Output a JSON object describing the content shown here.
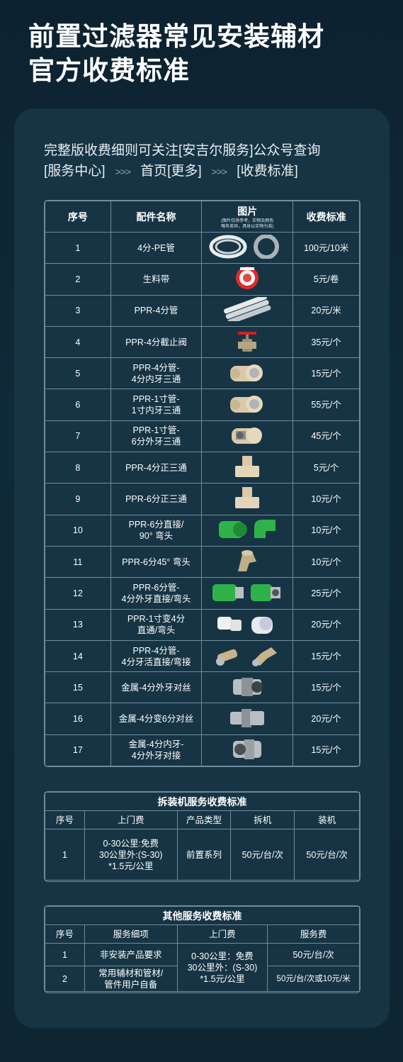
{
  "title_line1": "前置过滤器常见安装辅材",
  "title_line2": "官方收费标准",
  "intro": {
    "line1": "完整版收费细则可关注[安吉尔服务]公众号查询",
    "crumb1": "[服务中心]",
    "sep": ">>>",
    "crumb2": "首页[更多]",
    "crumb3": "[收费标准]"
  },
  "main_table": {
    "headers": {
      "no": "序号",
      "name": "配件名称",
      "image": "图片",
      "image_note1": "(图片仅供参考，实物及颜色",
      "image_note2": "略有差异，具体以实物为准)",
      "fee": "收费标准"
    },
    "rows": [
      {
        "no": "1",
        "name1": "4分-PE管",
        "name2": "",
        "fee": "100元/10米",
        "icon": "pe-pipe-coil-icon"
      },
      {
        "no": "2",
        "name1": "生料带",
        "name2": "",
        "fee": "5元/卷",
        "icon": "ptfe-tape-icon"
      },
      {
        "no": "3",
        "name1": "PPR-4分管",
        "name2": "",
        "fee": "20元/米",
        "icon": "ppr-pipes-icon"
      },
      {
        "no": "4",
        "name1": "PPR-4分截止阀",
        "name2": "",
        "fee": "35元/个",
        "icon": "stop-valve-icon"
      },
      {
        "no": "5",
        "name1": "PPR-4分管-",
        "name2": "4分内牙三通",
        "fee": "15元/个",
        "icon": "female-tee-icon"
      },
      {
        "no": "6",
        "name1": "PPR-1寸管-",
        "name2": "1寸内牙三通",
        "fee": "55元/个",
        "icon": "female-tee-icon"
      },
      {
        "no": "7",
        "name1": "PPR-1寸管-",
        "name2": "6分外牙三通",
        "fee": "45元/个",
        "icon": "male-tee-icon"
      },
      {
        "no": "8",
        "name1": "PPR-4分正三通",
        "name2": "",
        "fee": "5元/个",
        "icon": "equal-tee-icon"
      },
      {
        "no": "9",
        "name1": "PPR-6分正三通",
        "name2": "",
        "fee": "10元/个",
        "icon": "equal-tee-icon"
      },
      {
        "no": "10",
        "name1": "PPR-6分直接/",
        "name2": "90° 弯头",
        "fee": "10元/个",
        "icon": "green-coupling-elbow-icon"
      },
      {
        "no": "11",
        "name1": "PPR-6分45° 弯头",
        "name2": "",
        "fee": "10元/个",
        "icon": "elbow-45-icon"
      },
      {
        "no": "12",
        "name1": "PPR-6分管-",
        "name2": "4分外牙直接/弯头",
        "fee": "25元/个",
        "icon": "green-threaded-fittings-icon"
      },
      {
        "no": "13",
        "name1": "PPR-1寸变4分",
        "name2": "直通/弯头",
        "fee": "20元/个",
        "icon": "reducer-fittings-icon"
      },
      {
        "no": "14",
        "name1": "PPR-4分管-",
        "name2": "4分牙活直接/弯接",
        "fee": "15元/个",
        "icon": "union-fittings-icon"
      },
      {
        "no": "15",
        "name1": "金属-4分外牙对丝",
        "name2": "",
        "fee": "15元/个",
        "icon": "metal-nipple-icon"
      },
      {
        "no": "16",
        "name1": "金属-4分变6分对丝",
        "name2": "",
        "fee": "20元/个",
        "icon": "metal-reducing-nipple-icon"
      },
      {
        "no": "17",
        "name1": "金属-4分内牙-",
        "name2": "4分外牙对接",
        "fee": "15元/个",
        "icon": "metal-adapter-icon"
      }
    ]
  },
  "install_table": {
    "title": "拆装机服务收费标准",
    "headers": [
      "序号",
      "上门费",
      "产品类型",
      "拆机",
      "装机"
    ],
    "row": {
      "no": "1",
      "visit1": "0-30公里:免费",
      "visit2": "30公里外:(S-30)",
      "visit3": "*1.5元/公里",
      "type": "前置系列",
      "remove": "50元/台/次",
      "install": "50元/台/次"
    }
  },
  "other_table": {
    "title": "其他服务收费标准",
    "headers": [
      "序号",
      "服务细项",
      "上门费",
      "服务费"
    ],
    "visit1": "0-30公里：免费",
    "visit2": "30公里外：(S-30)",
    "visit3": "*1.5元/公里",
    "rows": [
      {
        "no": "1",
        "item1": "非安装产品要求",
        "item2": "",
        "fee": "50元/台/次"
      },
      {
        "no": "2",
        "item1": "常用辅材和管材/",
        "item2": "管件用户自备",
        "fee": "50元/台/次或10元/米"
      }
    ]
  },
  "colors": {
    "background": "#0d2230",
    "card": "#163444",
    "border": "#6f8d9c",
    "ppr_beige": "#d9c9a8",
    "ppr_green": "#2fb24a",
    "metal": "#b9bec2"
  }
}
